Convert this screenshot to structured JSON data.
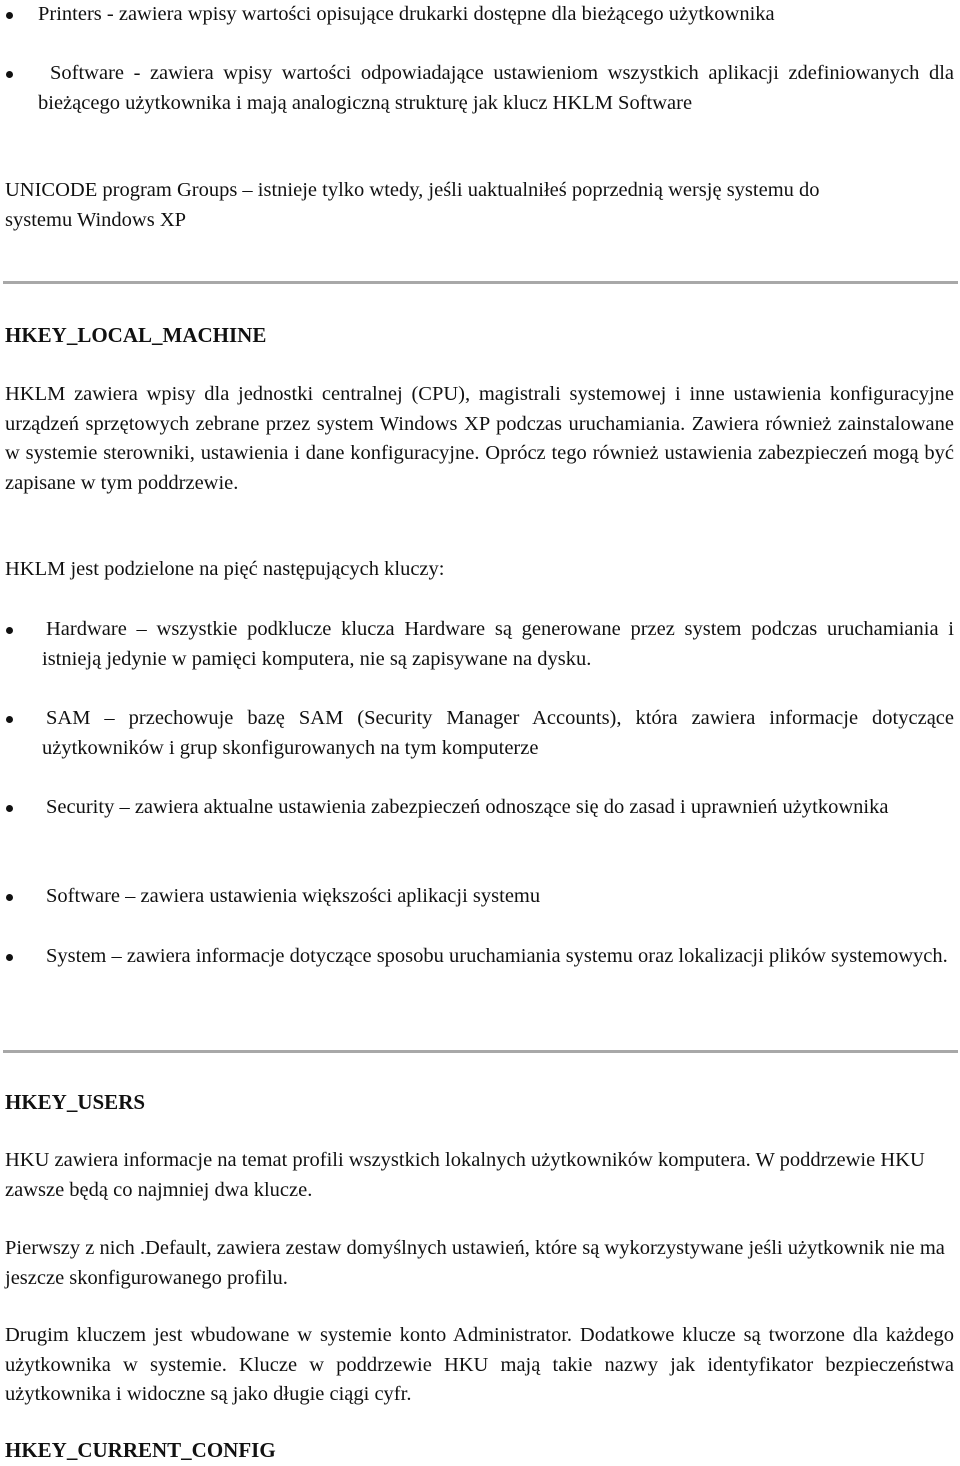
{
  "top_bullets": [
    "Printers - zawiera wpisy wartości opisujące drukarki dostępne dla bieżącego użytkownika",
    "Software - zawiera wpisy wartości odpowiadające ustawieniom wszystkich aplikacji zdefiniowanych dla bieżącego użytkownika i mają analogiczną strukturę jak klucz HKLM Software"
  ],
  "unicode_paragraph": "UNICODE program Groups – istnieje tylko wtedy, jeśli uaktualniłeś poprzednią wersję systemu do systemu Windows XP",
  "hklm": {
    "heading": "HKEY_LOCAL_MACHINE",
    "description": "HKLM zawiera wpisy dla jednostki centralnej (CPU), magistrali systemowej i inne ustawienia konfiguracyjne urządzeń sprzętowych zebrane przez system Windows XP podczas uruchamiania. Zawiera również zainstalowane w systemie sterowniki, ustawienia i dane konfiguracyjne. Oprócz tego również ustawienia zabezpieczeń mogą być zapisane w tym poddrzewie.",
    "intro": "HKLM jest podzielone na pięć następujących kluczy:",
    "keys": [
      "Hardware – wszystkie podklucze klucza Hardware są generowane przez system podczas uruchamiania i istnieją jedynie w pamięci komputera, nie są zapisywane na dysku.",
      "SAM – przechowuje bazę SAM (Security Manager Accounts), która zawiera informacje dotyczące użytkowników i grup skonfigurowanych na tym komputerze",
      "Security – zawiera aktualne ustawienia zabezpieczeń odnoszące się do zasad i uprawnień użytkownika",
      "Software – zawiera ustawienia większości aplikacji systemu",
      "System – zawiera informacje dotyczące sposobu uruchamiania systemu oraz lokalizacji plików systemowych."
    ]
  },
  "hku": {
    "heading": "HKEY_USERS",
    "paragraphs": [
      "HKU zawiera informacje na temat profili wszystkich lokalnych użytkowników komputera. W poddrzewie HKU zawsze będą co najmniej dwa klucze.",
      "Pierwszy z nich .Default, zawiera zestaw domyślnych ustawień, które są wykorzystywane jeśli użytkownik nie ma jeszcze skonfigurowanego profilu.",
      "Drugim kluczem jest wbudowane w systemie konto Administrator. Dodatkowe klucze są tworzone dla każdego użytkownika w systemie. Klucze w poddrzewie HKU mają takie nazwy jak identyfikator bezpieczeństwa użytkownika i widoczne są jako długie ciągi cyfr."
    ]
  },
  "hkcc": {
    "heading": "HKEY_CURRENT_CONFIG"
  }
}
